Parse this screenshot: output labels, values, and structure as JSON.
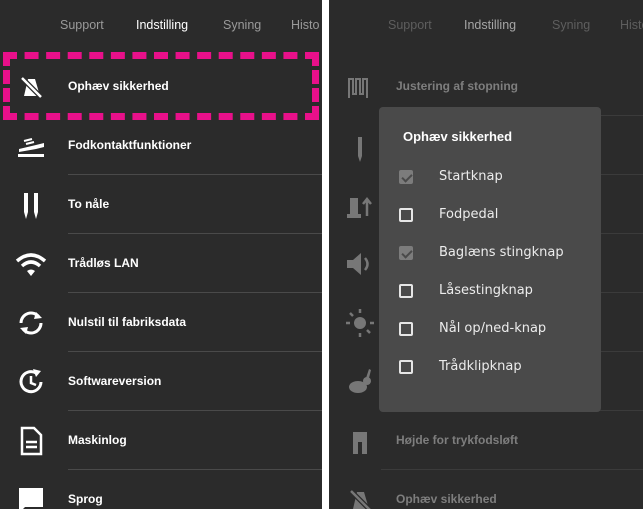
{
  "tabs": [
    "Support",
    "Indstilling",
    "Syning",
    "Histo"
  ],
  "active_tab": "Indstilling",
  "left_menu": [
    {
      "label": "Ophæv sikkerhed",
      "icon": "safety-off-icon"
    },
    {
      "label": "Fodkontaktfunktioner",
      "icon": "foot-control-icon"
    },
    {
      "label": "To nåle",
      "icon": "twin-needle-icon"
    },
    {
      "label": "Trådløs LAN",
      "icon": "wifi-icon"
    },
    {
      "label": "Nulstil til fabriksdata",
      "icon": "reset-icon"
    },
    {
      "label": "Softwareversion",
      "icon": "software-update-icon"
    },
    {
      "label": "Maskinlog",
      "icon": "document-icon"
    },
    {
      "label": "Sprog",
      "icon": "speech-bubble-icon"
    }
  ],
  "right_menu": [
    {
      "label": "Justering af stopning",
      "icon": "darning-icon"
    },
    {
      "label": "",
      "icon": "needle-icon"
    },
    {
      "label": "",
      "icon": "presser-foot-icon"
    },
    {
      "label": "",
      "icon": "speaker-icon"
    },
    {
      "label": "",
      "icon": "brightness-icon"
    },
    {
      "label": "",
      "icon": "rabbit-icon"
    },
    {
      "label": "Højde for trykfodsløft",
      "icon": "presser-height-icon"
    },
    {
      "label": "Ophæv sikkerhed",
      "icon": "safety-off-icon"
    }
  ],
  "dialog": {
    "title": "Ophæv sikkerhed",
    "options": [
      {
        "label": "Startknap",
        "checked": true
      },
      {
        "label": "Fodpedal",
        "checked": false
      },
      {
        "label": "Baglæns stingknap",
        "checked": true
      },
      {
        "label": "Låsestingknap",
        "checked": false
      },
      {
        "label": "Nål op/ned-knap",
        "checked": false
      },
      {
        "label": "Trådklipknap",
        "checked": false
      }
    ]
  },
  "colors": {
    "highlight": "#e8108a",
    "panel_bg": "#2b2b2b",
    "dialog_bg": "#4a4a4a"
  }
}
